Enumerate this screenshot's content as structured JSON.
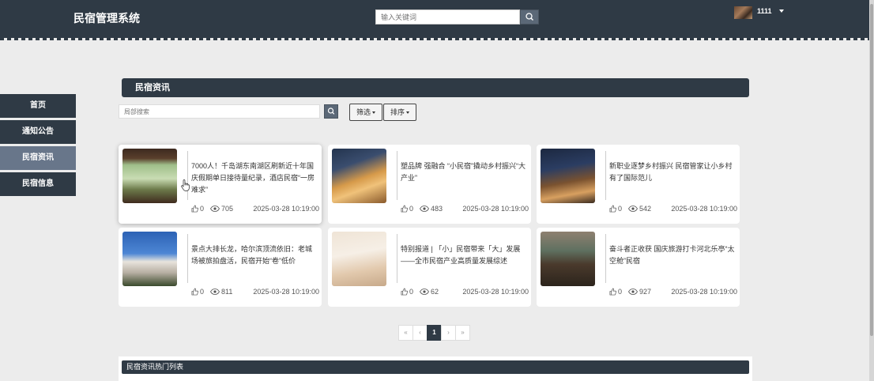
{
  "header": {
    "brand": "民宿管理系统",
    "search_placeholder": "输入关键词",
    "username": "1111"
  },
  "sidebar": {
    "items": [
      {
        "label": "首页",
        "active": false
      },
      {
        "label": "通知公告",
        "active": false
      },
      {
        "label": "民宿资讯",
        "active": true
      },
      {
        "label": "民宿信息",
        "active": false
      }
    ]
  },
  "main": {
    "panel_title": "民宿资讯",
    "local_search_placeholder": "局部搜索",
    "filter_label": "筛选",
    "sort_label": "排序",
    "cards": [
      {
        "title": "7000人！千岛湖东南湖区刷新近十年国庆假期单日接待量纪录，酒店民宿“一房难求”",
        "likes": "0",
        "views": "705",
        "date": "2025-03-28 10:19:00"
      },
      {
        "title": "塑品牌 强融合 “小民宿”撬动乡村振兴“大产业”",
        "likes": "0",
        "views": "483",
        "date": "2025-03-28 10:19:00"
      },
      {
        "title": "新职业逐梦乡村振兴 民宿管家让小乡村有了国际范儿",
        "likes": "0",
        "views": "542",
        "date": "2025-03-28 10:19:00"
      },
      {
        "title": "景点大排长龙，哈尔滨顶流依旧：老城场被旅拍盘活，民宿开始“卷”低价",
        "likes": "0",
        "views": "811",
        "date": "2025-03-28 10:19:00"
      },
      {
        "title": "特别报道 | 「小」民宿带来「大」发展——全市民宿产业高质量发展综述",
        "likes": "0",
        "views": "62",
        "date": "2025-03-28 10:19:00"
      },
      {
        "title": "奋斗者正收获 国庆旅游打卡河北乐亭“太空舱”民宿",
        "likes": "0",
        "views": "927",
        "date": "2025-03-28 10:19:00"
      }
    ]
  },
  "pagination": {
    "first": "«",
    "prev": "‹",
    "current": "1",
    "next": "›",
    "last": "»"
  },
  "hot_list": {
    "title": "民宿资讯热门列表"
  },
  "colors": {
    "dark": "#2f3a45",
    "active_nav": "#68768a",
    "background": "#ececec"
  }
}
